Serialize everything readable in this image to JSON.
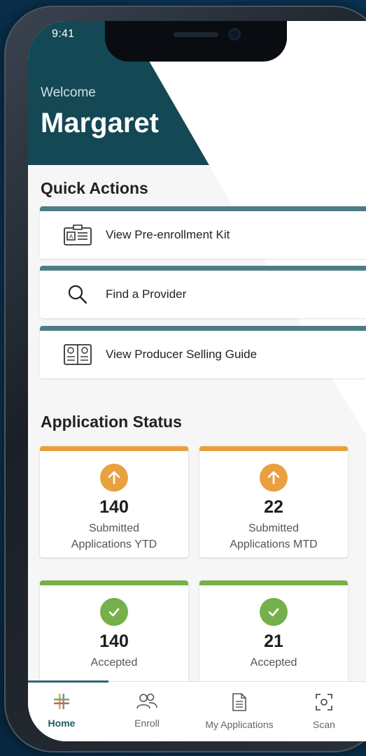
{
  "status_bar": {
    "time": "9:41"
  },
  "header": {
    "welcome": "Welcome",
    "name": "Margaret"
  },
  "quick_actions": {
    "title": "Quick Actions",
    "items": [
      {
        "label": "View Pre-enrollment Kit",
        "icon": "id-card-icon"
      },
      {
        "label": "Find a Provider",
        "icon": "search-icon"
      },
      {
        "label": "View Producer Selling Guide",
        "icon": "guide-book-icon"
      }
    ]
  },
  "application_status": {
    "title": "Application Status",
    "cards": [
      {
        "value": "140",
        "line1": "Submitted",
        "line2": "Applications YTD",
        "icon": "arrow-up-icon",
        "color": "#e9a03f"
      },
      {
        "value": "22",
        "line1": "Submitted",
        "line2": "Applications MTD",
        "icon": "arrow-up-icon",
        "color": "#e9a03f"
      },
      {
        "value": "140",
        "line1": "Accepted",
        "line2": "",
        "icon": "check-icon",
        "color": "#75b04a"
      },
      {
        "value": "21",
        "line1": "Accepted",
        "line2": "",
        "icon": "check-icon",
        "color": "#75b04a"
      }
    ]
  },
  "bottom_nav": {
    "items": [
      {
        "label": "Home",
        "icon": "home-logo-icon",
        "active": true
      },
      {
        "label": "Enroll",
        "icon": "people-icon",
        "active": false
      },
      {
        "label": "My Applications",
        "icon": "document-icon",
        "active": false
      },
      {
        "label": "Scan",
        "icon": "scan-icon",
        "active": false
      }
    ]
  },
  "colors": {
    "header": "#134854",
    "card_accent": "#4d7d84",
    "orange": "#e9a03f",
    "green": "#75b04a"
  }
}
